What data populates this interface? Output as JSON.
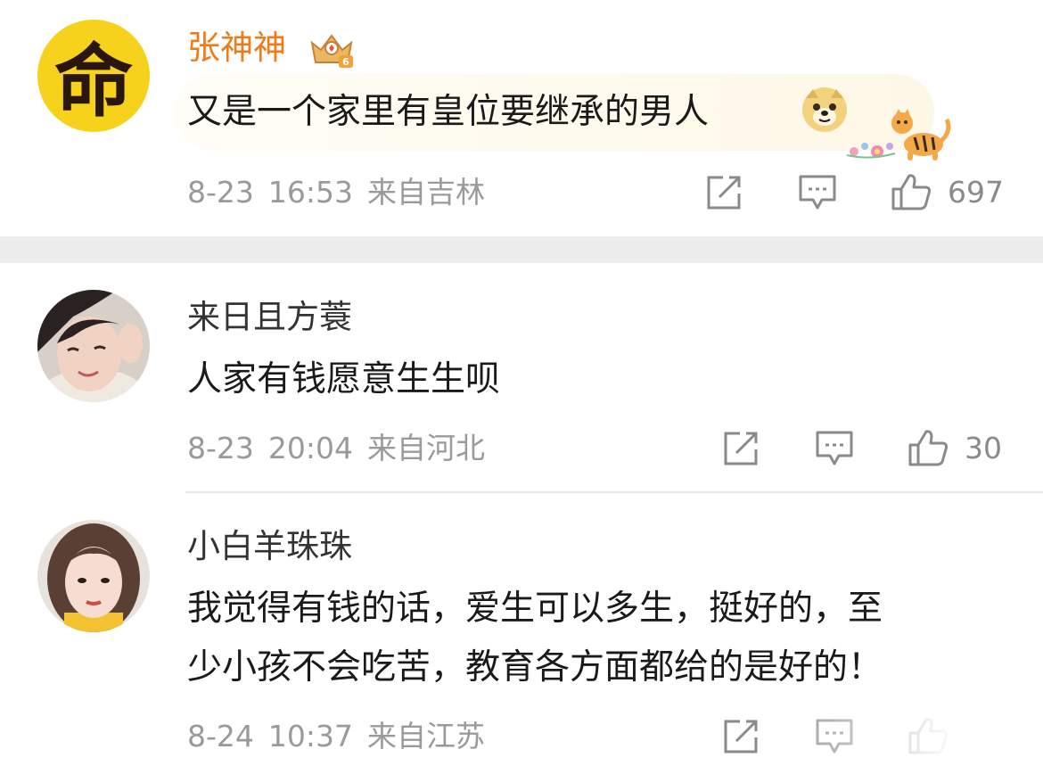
{
  "comments": [
    {
      "user": "张神神",
      "text": "又是一个家里有皇位要继承的男人",
      "date": "8-23",
      "time": "16:53",
      "location": "来自吉林",
      "likes": "697",
      "avatar_glyph": "命",
      "badge_icon": "crown-level-badge-icon",
      "emoji_icon": "doge-emoji-icon",
      "decoration_icon": "tiger-bubble-decoration-icon"
    },
    {
      "user": "来日且方蓑",
      "text": "人家有钱愿意生生呗",
      "date": "8-23",
      "time": "20:04",
      "location": "来自河北",
      "likes": "30"
    },
    {
      "user": "小白羊珠珠",
      "text_line1": "我觉得有钱的话，爱生可以多生，挺好的，至",
      "text_line2": "少小孩不会吃苦，教育各方面都给的是好的！",
      "date": "8-24",
      "time": "10:37",
      "location": "来自江苏"
    }
  ],
  "colors": {
    "vip_name": "#f07a16",
    "text": "#1a1a1a",
    "meta": "#9a9a9a",
    "icon": "#8a8a8a",
    "divider": "#ececec",
    "avatar_yellow": "#f6d21c"
  },
  "icons": {
    "share": "share-icon",
    "comment": "comment-icon",
    "like": "like-icon"
  }
}
